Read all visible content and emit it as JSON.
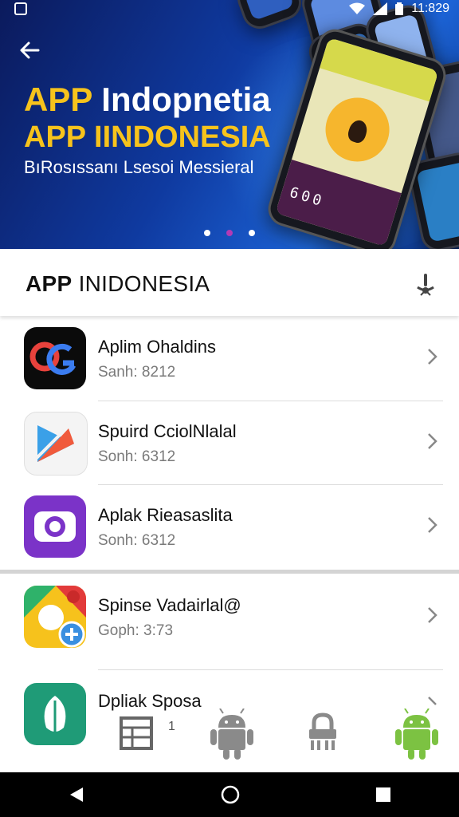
{
  "status_bar": {
    "time": "11:829"
  },
  "hero": {
    "title_part1": "APP",
    "title_part2": "Indopnetia",
    "subtitle": "APP IINDONESIA",
    "description": "BıRosıssanı Lsesoi Messieral",
    "carousel_dots": 3,
    "carousel_active": 1,
    "phone_screen_number": "600"
  },
  "section": {
    "title_bold": "APP",
    "title_rest": " INIDONESIA"
  },
  "apps": [
    {
      "name": "Aplim Ohaldins",
      "sub": "Sanh: 8212"
    },
    {
      "name": "Spuird CciolNlalal",
      "sub": "Sonh: 6312"
    },
    {
      "name": "Aplak Rieasaslita",
      "sub": "Sonh: 6312"
    },
    {
      "name": "Spinse Vadairlal@",
      "sub": "Goph: 3:73"
    },
    {
      "name": "Dpliak Sposa",
      "sub": ""
    }
  ],
  "bottom_dock": {
    "badge": "1"
  },
  "colors": {
    "accent_yellow": "#f7c31c",
    "android_green": "#7cc242",
    "dot_active": "#b23ab5"
  },
  "icons": [
    "back-arrow-icon",
    "wifi-icon",
    "signal-icon",
    "battery-icon",
    "mic-icon",
    "chevron-right-icon",
    "list-icon",
    "android-icon",
    "lock-icon",
    "back-nav-icon",
    "home-nav-icon",
    "recents-nav-icon"
  ]
}
